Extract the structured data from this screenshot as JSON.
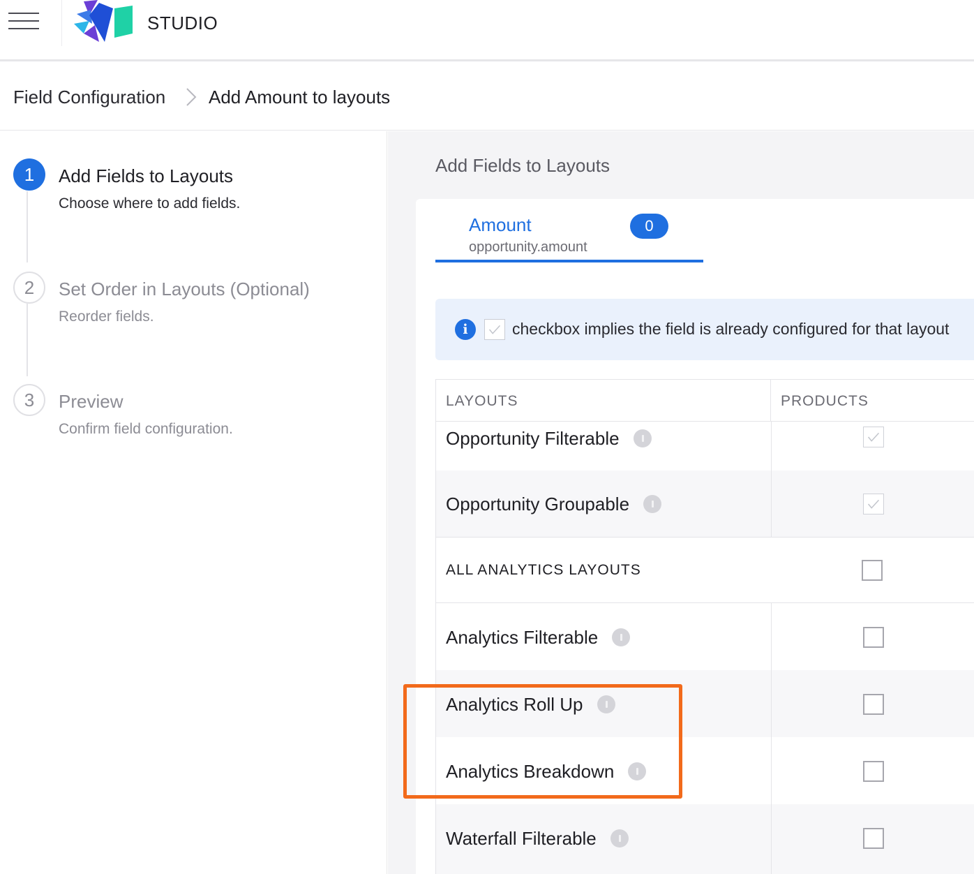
{
  "app": {
    "brand": "STUDIO"
  },
  "breadcrumb": {
    "parent": "Field Configuration",
    "current": "Add Amount to layouts"
  },
  "steps": [
    {
      "number": "1",
      "title": "Add Fields to Layouts",
      "subtitle": "Choose where to add fields.",
      "state": "active"
    },
    {
      "number": "2",
      "title": "Set Order in Layouts (Optional)",
      "subtitle": "Reorder fields.",
      "state": "inactive"
    },
    {
      "number": "3",
      "title": "Preview",
      "subtitle": "Confirm field configuration.",
      "state": "inactive"
    }
  ],
  "main": {
    "title": "Add Fields to Layouts",
    "tab": {
      "name": "Amount",
      "path": "opportunity.amount",
      "count": "0"
    },
    "info": {
      "text": "checkbox implies the field is already configured for that layout"
    },
    "table": {
      "columns": [
        "LAYOUTS",
        "PRODUCTS"
      ],
      "rows": [
        {
          "label": "Opportunity Filterable",
          "checked": true,
          "has_info": true
        },
        {
          "label": "Opportunity Groupable",
          "checked": true,
          "has_info": true
        },
        {
          "label": "ALL ANALYTICS LAYOUTS",
          "checked": false,
          "has_info": false,
          "group": true
        },
        {
          "label": "Analytics Filterable",
          "checked": false,
          "has_info": true
        },
        {
          "label": "Analytics Roll Up",
          "checked": false,
          "has_info": true
        },
        {
          "label": "Analytics Breakdown",
          "checked": false,
          "has_info": true
        },
        {
          "label": "Waterfall Filterable",
          "checked": false,
          "has_info": true
        }
      ]
    }
  },
  "colors": {
    "accent": "#1f6fe0",
    "highlight": "#f26a1b"
  }
}
